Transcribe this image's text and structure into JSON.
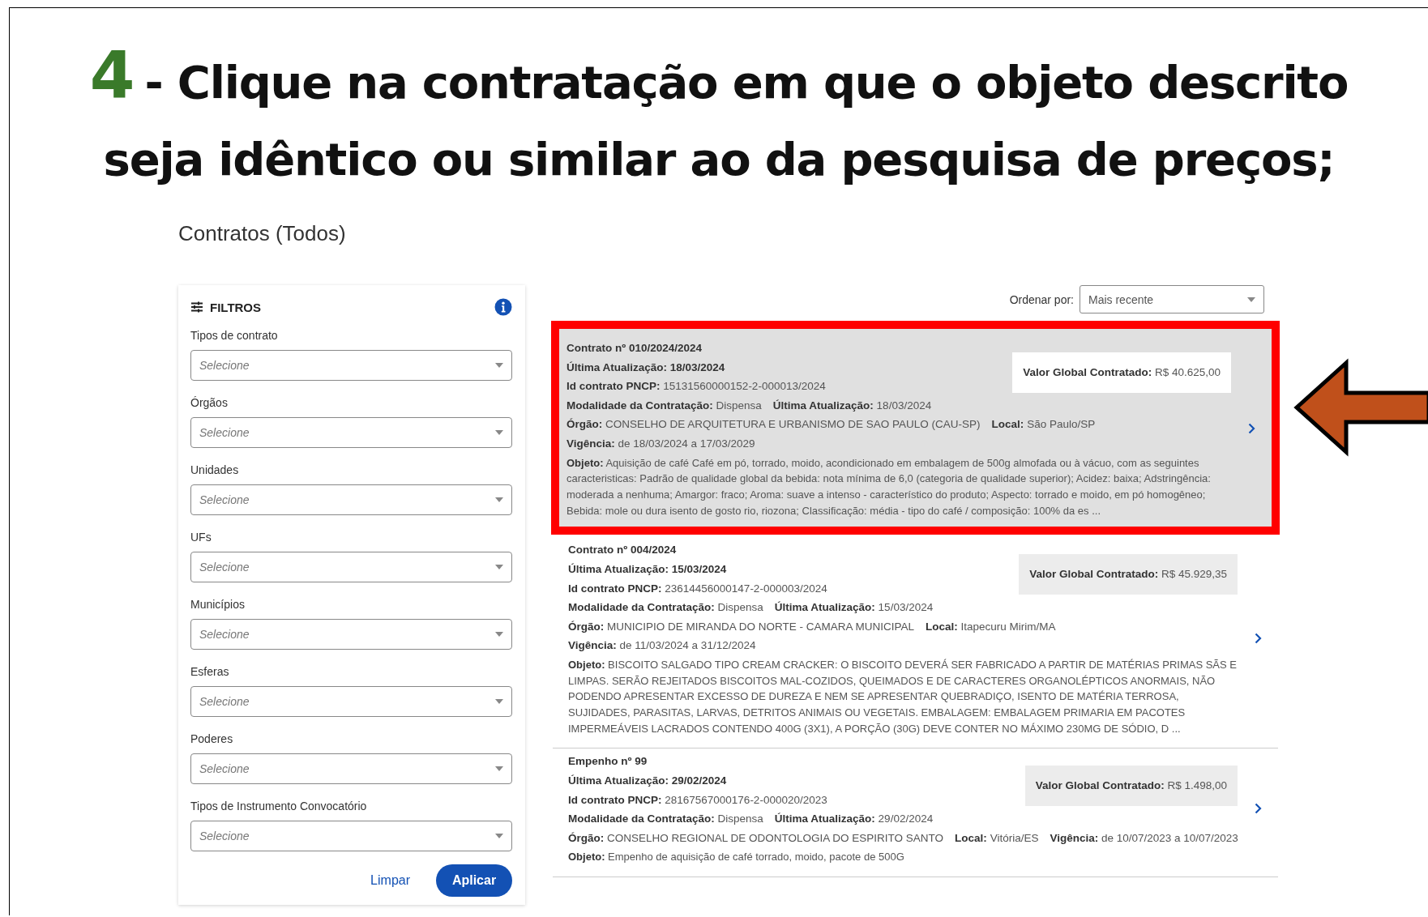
{
  "slide": {
    "step_number": "4",
    "instruction": "- Clique na contratação em que o objeto descrito seja idêntico ou similar ao da pesquisa de preços;"
  },
  "page_title": "Contratos (Todos)",
  "filters": {
    "title": "FILTROS",
    "fields": [
      {
        "label": "Tipos de contrato",
        "placeholder": "Selecione"
      },
      {
        "label": "Órgãos",
        "placeholder": "Selecione"
      },
      {
        "label": "Unidades",
        "placeholder": "Selecione"
      },
      {
        "label": "UFs",
        "placeholder": "Selecione"
      },
      {
        "label": "Municípios",
        "placeholder": "Selecione"
      },
      {
        "label": "Esferas",
        "placeholder": "Selecione"
      },
      {
        "label": "Poderes",
        "placeholder": "Selecione"
      },
      {
        "label": "Tipos de Instrumento Convocatório",
        "placeholder": "Selecione"
      }
    ],
    "clear_button": "Limpar",
    "apply_button": "Aplicar"
  },
  "sort": {
    "label": "Ordenar por:",
    "value": "Mais recente"
  },
  "results": [
    {
      "selected": true,
      "heading": [
        "Contrato nº 010/2024/2024",
        "Última Atualização: 18/03/2024"
      ],
      "value": "**Valor Global Contratado:** R$ 40.625,00",
      "lines": [
        [
          "**Id contrato PNCP:** 15131560000152-2-000013/2024"
        ],
        [
          "**Modalidade da Contratação:** Dispensa",
          "**Última Atualização:** 18/03/2024"
        ],
        [
          "**Órgão:** CONSELHO DE ARQUITETURA E URBANISMO DE SAO PAULO (CAU-SP)",
          "**Local:** São Paulo/SP"
        ],
        [
          "**Vigência:** de 18/03/2024 a 17/03/2029"
        ]
      ],
      "objeto": "**Objeto:** Aquisição de café Café em pó, torrado, moido, acondicionado em embalagem de 500g almofada ou à vácuo, com as seguintes caracteristicas: Padrão de qualidade global da bebida: nota mínima de 6,0 (categoria de qualidade superior); Acidez: baixa; Adstringência: moderada a nenhuma; Amargor: fraco; Aroma: suave a intenso - característico do produto; Aspecto: torrado e moido, em pó homogêneo; Bebida: mole ou dura isento de gosto rio, riozona; Classificação: média - tipo do café / composição: 100% da es ..."
    },
    {
      "selected": false,
      "heading": [
        "Contrato nº 004/2024",
        "Última Atualização: 15/03/2024"
      ],
      "value": "**Valor Global Contratado:** R$ 45.929,35",
      "lines": [
        [
          "**Id contrato PNCP:** 23614456000147-2-000003/2024"
        ],
        [
          "**Modalidade da Contratação:** Dispensa",
          "**Última Atualização:** 15/03/2024"
        ],
        [
          "**Órgão:** MUNICIPIO DE MIRANDA DO NORTE - CAMARA MUNICIPAL",
          "**Local:** Itapecuru Mirim/MA"
        ],
        [
          "**Vigência:** de 11/03/2024 a 31/12/2024"
        ]
      ],
      "objeto": "**Objeto:** BISCOITO SALGADO TIPO CREAM CRACKER: O BISCOITO DEVERÁ SER FABRICADO A PARTIR DE MATÉRIAS PRIMAS SÃS E LIMPAS. SERÃO REJEITADOS BISCOITOS MAL-COZIDOS, QUEIMADOS E DE CARACTERES ORGANOLÉPTICOS ANORMAIS, NÃO PODENDO APRESENTAR EXCESSO DE DUREZA E NEM SE APRESENTAR QUEBRADIÇO, ISENTO DE MATÉRIA TERROSA, SUJIDADES, PARASITAS, LARVAS, DETRITOS ANIMAIS OU VEGETAIS. EMBALAGEM: EMBALAGEM PRIMARIA EM PACOTES IMPERMEÁVEIS LACRADOS CONTENDO 400G (3X1), A PORÇÃO (30G) DEVE CONTER NO MÁXIMO 230MG DE SÓDIO, D ..."
    },
    {
      "selected": false,
      "heading": [
        "Empenho nº 99",
        "Última Atualização: 29/02/2024"
      ],
      "value": "**Valor Global Contratado:** R$ 1.498,00",
      "lines": [
        [
          "**Id contrato PNCP:** 28167567000176-2-000020/2023"
        ],
        [
          "**Modalidade da Contratação:** Dispensa",
          "**Última Atualização:** 29/02/2024"
        ],
        [
          "**Órgão:** CONSELHO REGIONAL DE ODONTOLOGIA DO ESPIRITO SANTO",
          "**Local:** Vitória/ES",
          "**Vigência:** de 10/07/2023 a 10/07/2023"
        ]
      ],
      "objeto": "**Objeto:** Empenho de aquisição de café torrado, moido, pacote de 500G"
    }
  ]
}
